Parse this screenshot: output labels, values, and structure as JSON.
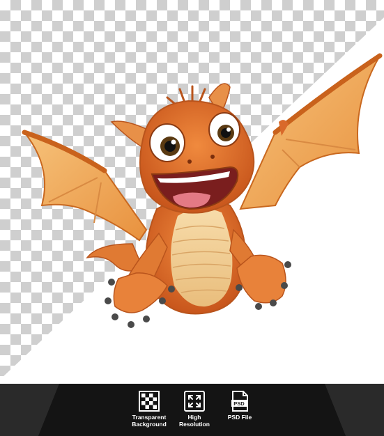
{
  "badges": [
    {
      "icon": "checkerboard-icon",
      "label": "Transparent\nBackground"
    },
    {
      "icon": "expand-arrows-icon",
      "label": "High\nResolution"
    },
    {
      "icon": "psd-file-icon",
      "label": "PSD File",
      "file_tag": "PSD"
    }
  ],
  "colors": {
    "footer_bg": "#1c1c1c",
    "dragon_body": "#e0702a",
    "dragon_belly": "#f3d3a0",
    "wing_membrane": "#f0b062"
  }
}
